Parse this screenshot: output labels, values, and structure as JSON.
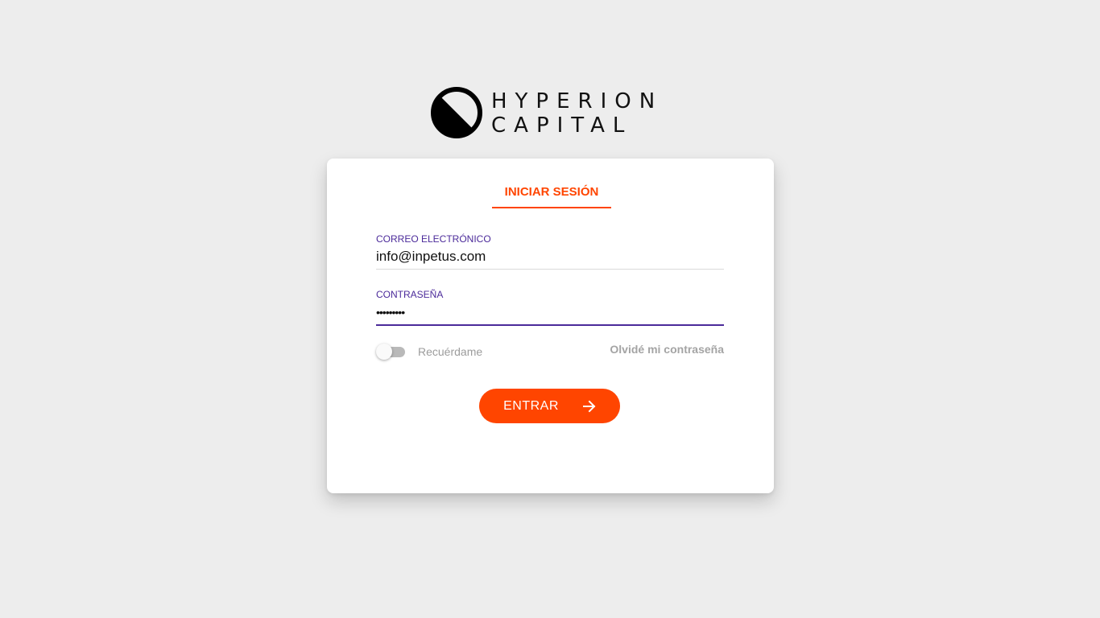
{
  "brand": {
    "logo_line1": "HYPERION",
    "logo_line2": "CAPITAL",
    "accent_color": "#ff4500",
    "focus_color": "#4b2a9a",
    "background_color": "#ededed"
  },
  "login": {
    "tab_label": "INICIAR SESIÓN",
    "email_label": "CORREO ELECTRÓNICO",
    "email_value": "info@inpetus.com",
    "password_label": "CONTRASEÑA",
    "password_value": "•••••••••",
    "remember_label": "Recuérdame",
    "remember_checked": false,
    "forgot_label": "Olvidé mi contraseña",
    "submit_label": "ENTRAR",
    "submit_icon": "arrow-right-icon"
  }
}
